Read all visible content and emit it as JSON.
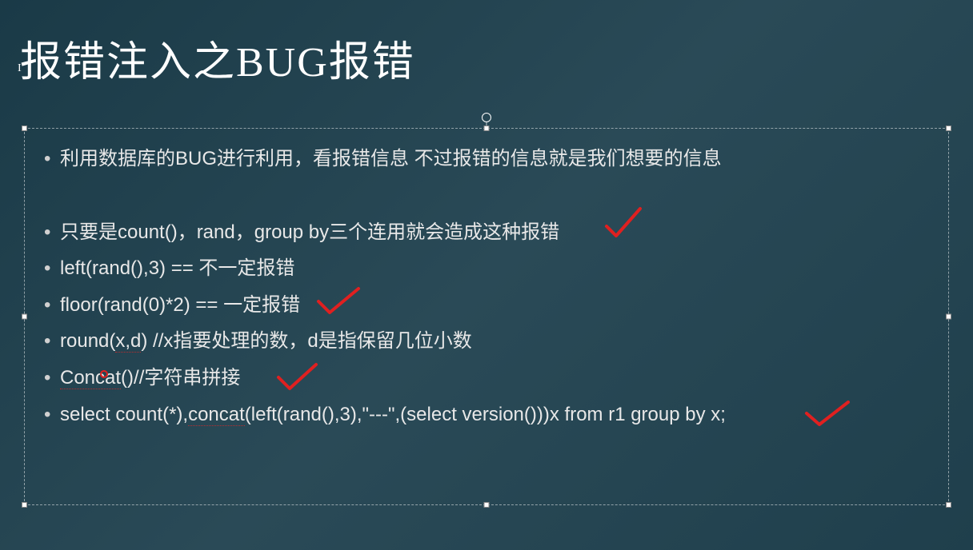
{
  "title": "报错注入之BUG报错",
  "bullets": {
    "b1": "利用数据库的BUG进行利用，看报错信息 不过报错的信息就是我们想要的信息",
    "b2": "只要是count()，rand，group by三个连用就会造成这种报错",
    "b3_prefix": "left(rand(),3) == ",
    "b3_suffix": "不一定报错",
    "b4_prefix": "floor(",
    "b4_mid": "rand(0)*2) == ",
    "b4_suffix": "一定报错",
    "b5_prefix": "round(",
    "b5_xd": "x,d",
    "b5_suffix": ") //x指要处理的数，d是指保留几位小数",
    "b6_concat": "Concat",
    "b6_suffix": "()//字符串拼接",
    "b7_a": "select count(*),",
    "b7_b": "concat",
    "b7_c": "(left(rand(),3),\"---\",(select version()))x from r1 group by x;"
  }
}
